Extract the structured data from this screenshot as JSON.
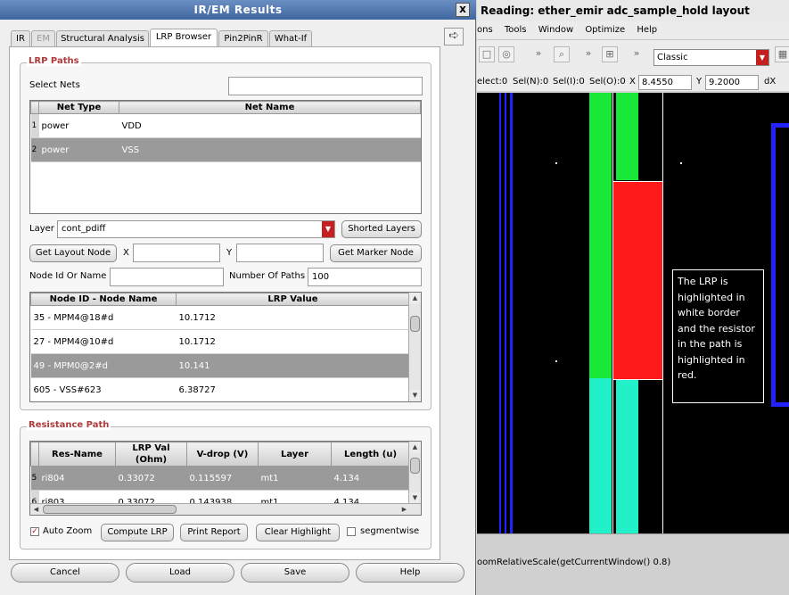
{
  "dialog": {
    "title": "IR/EM Results",
    "close": "x",
    "tabs": [
      {
        "label": "IR",
        "state": "normal"
      },
      {
        "label": "EM",
        "state": "disabled"
      },
      {
        "label": "Structural Analysis",
        "state": "normal"
      },
      {
        "label": "LRP Browser",
        "state": "active"
      },
      {
        "label": "Pin2PinR",
        "state": "normal"
      },
      {
        "label": "What-If",
        "state": "normal"
      }
    ],
    "lrp_paths": {
      "title": "LRP Paths",
      "select_nets_label": "Select Nets",
      "select_nets_value": "",
      "nets_table": {
        "columns": [
          "Net Type",
          "Net Name"
        ],
        "rows": [
          {
            "num": "1",
            "type": "power",
            "name": "VDD",
            "selected": false
          },
          {
            "num": "2",
            "type": "power",
            "name": "VSS",
            "selected": true
          }
        ]
      },
      "layer_label": "Layer",
      "layer_value": "cont_pdiff",
      "shorted_layers_button": "Shorted Layers",
      "get_layout_node_button": "Get Layout Node",
      "x_label": "X",
      "x_value": "",
      "y_label": "Y",
      "y_value": "",
      "get_marker_node_button": "Get Marker Node",
      "node_id_label": "Node Id Or Name",
      "node_id_value": "",
      "num_paths_label": "Number Of Paths",
      "num_paths_value": "100",
      "node_table": {
        "columns": [
          "Node ID - Node Name",
          "LRP Value"
        ],
        "rows": [
          {
            "node": "35 - MPM4@18#d",
            "value": "10.1712",
            "selected": false
          },
          {
            "node": "27 - MPM4@10#d",
            "value": "10.1712",
            "selected": false
          },
          {
            "node": "49 - MPM0@2#d",
            "value": "10.141",
            "selected": true
          },
          {
            "node": "605 - VSS#623",
            "value": "6.38727",
            "selected": false
          }
        ]
      }
    },
    "resistance_path": {
      "title": "Resistance Path",
      "table": {
        "columns": [
          "Res-Name",
          "LRP Val (Ohm)",
          "V-drop (V)",
          "Layer",
          "Length (u)"
        ],
        "rows": [
          {
            "num": "5",
            "res": "ri804",
            "lrp": "0.33072",
            "vdrop": "0.115597",
            "layer": "mt1",
            "length": "4.134",
            "selected": true
          },
          {
            "num": "6",
            "res": "ri803",
            "lrp": "0.33072",
            "vdrop": "0.143938",
            "layer": "mt1",
            "length": "4.134",
            "selected": false
          }
        ]
      },
      "auto_zoom_label": "Auto Zoom",
      "auto_zoom_checked": true,
      "compute_lrp_button": "Compute LRP",
      "print_report_button": "Print Report",
      "clear_highlight_button": "Clear Highlight",
      "segmentwise_label": "segmentwise",
      "segmentwise_checked": false
    },
    "buttons": {
      "cancel": "Cancel",
      "load": "Load",
      "save": "Save",
      "help": "Help"
    }
  },
  "layout_window": {
    "title": "Reading: ether_emir adc_sample_hold layout",
    "menu": [
      "ons",
      "Tools",
      "Window",
      "Optimize",
      "Help"
    ],
    "view_mode": "Classic",
    "status": {
      "select": "elect:0",
      "sel_n": "Sel(N):0",
      "sel_i": "Sel(I):0",
      "sel_o": "Sel(O):0",
      "x_label": "X",
      "x_value": "8.4550",
      "y_label": "Y",
      "y_value": "9.2000",
      "dx_label": "dX"
    },
    "annotation": "The LRP is highlighted in white border and the resistor in the path is highlighted in red.",
    "command_line": "oomRelativeScale(getCurrentWindow() 0.8)",
    "colors": {
      "green": "#18e838",
      "cyan": "#22f0c8",
      "red": "#ff1a1a",
      "blue": "#2222ff"
    }
  }
}
